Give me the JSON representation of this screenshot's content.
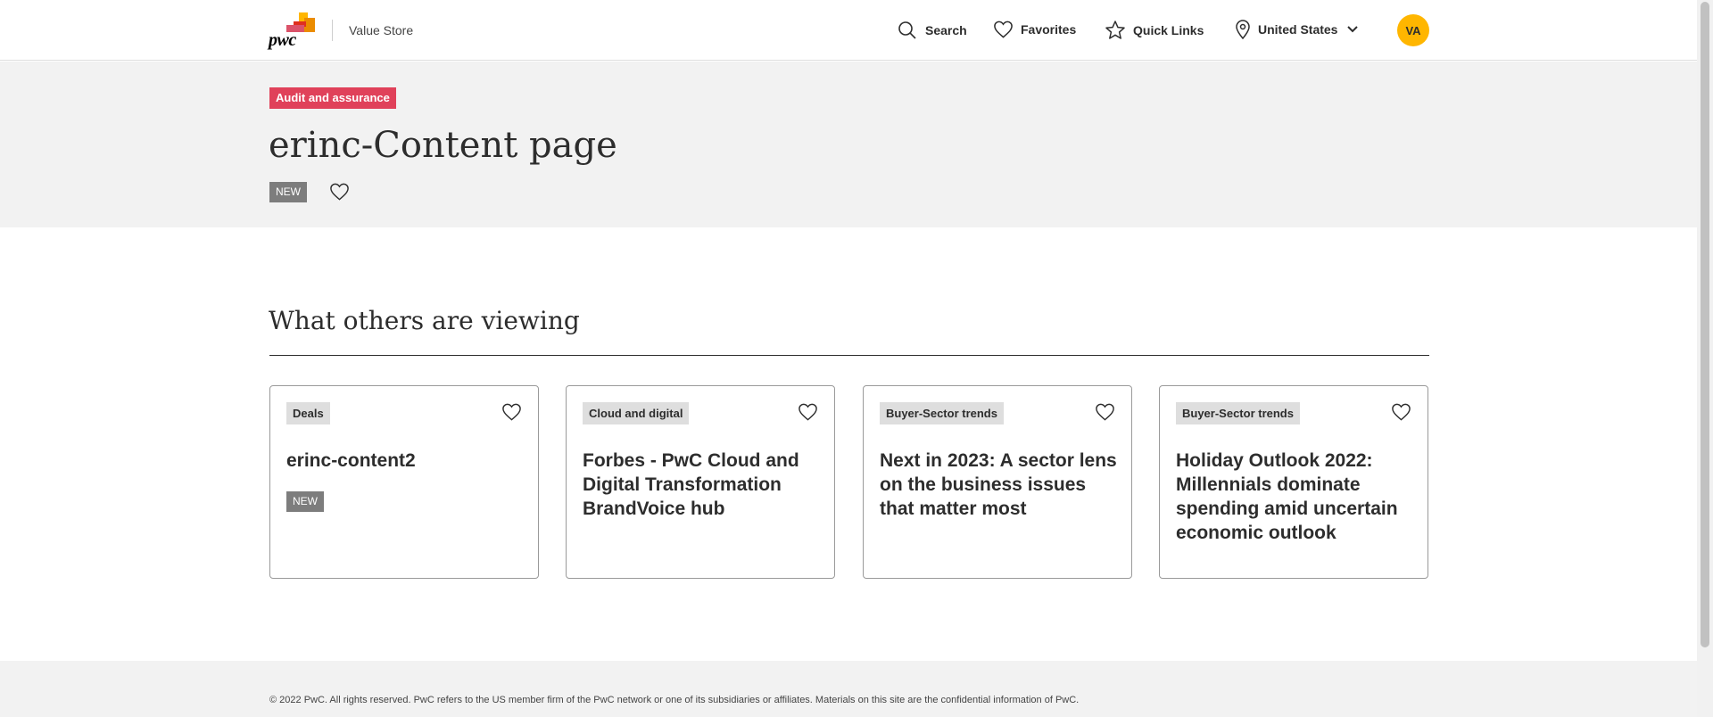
{
  "header": {
    "logo_text": "pwc",
    "store_name": "Value Store",
    "nav": {
      "search": "Search",
      "favorites": "Favorites",
      "quick_links": "Quick Links",
      "country": "United States"
    },
    "avatar_initials": "VA"
  },
  "hero": {
    "category_tag": "Audit and assurance",
    "title": "erinc-Content page",
    "new_badge": "NEW"
  },
  "section": {
    "title": "What others are viewing",
    "cards": [
      {
        "tag": "Deals",
        "title": "erinc-content2",
        "badge": "NEW"
      },
      {
        "tag": "Cloud and digital",
        "title": "Forbes - PwC Cloud and Digital Transformation BrandVoice hub"
      },
      {
        "tag": "Buyer-Sector trends",
        "title": "Next in 2023: A sector lens on the business issues that matter most"
      },
      {
        "tag": "Buyer-Sector trends",
        "title": "Holiday Outlook 2022: Millennials dominate spending amid uncertain economic outlook"
      }
    ]
  },
  "footer": {
    "text": "© 2022 PwC. All rights reserved. PwC refers to the US member firm of the PwC network or one of its subsidiaries or affiliates. Materials on this site are the confidential information of PwC."
  },
  "colors": {
    "accent_red": "#e0415a",
    "avatar_yellow": "#ffb600",
    "hero_bg": "#f2f2f2"
  },
  "icons": [
    "search-icon",
    "heart-icon",
    "star-icon",
    "location-pin-icon",
    "chevron-down-icon"
  ]
}
